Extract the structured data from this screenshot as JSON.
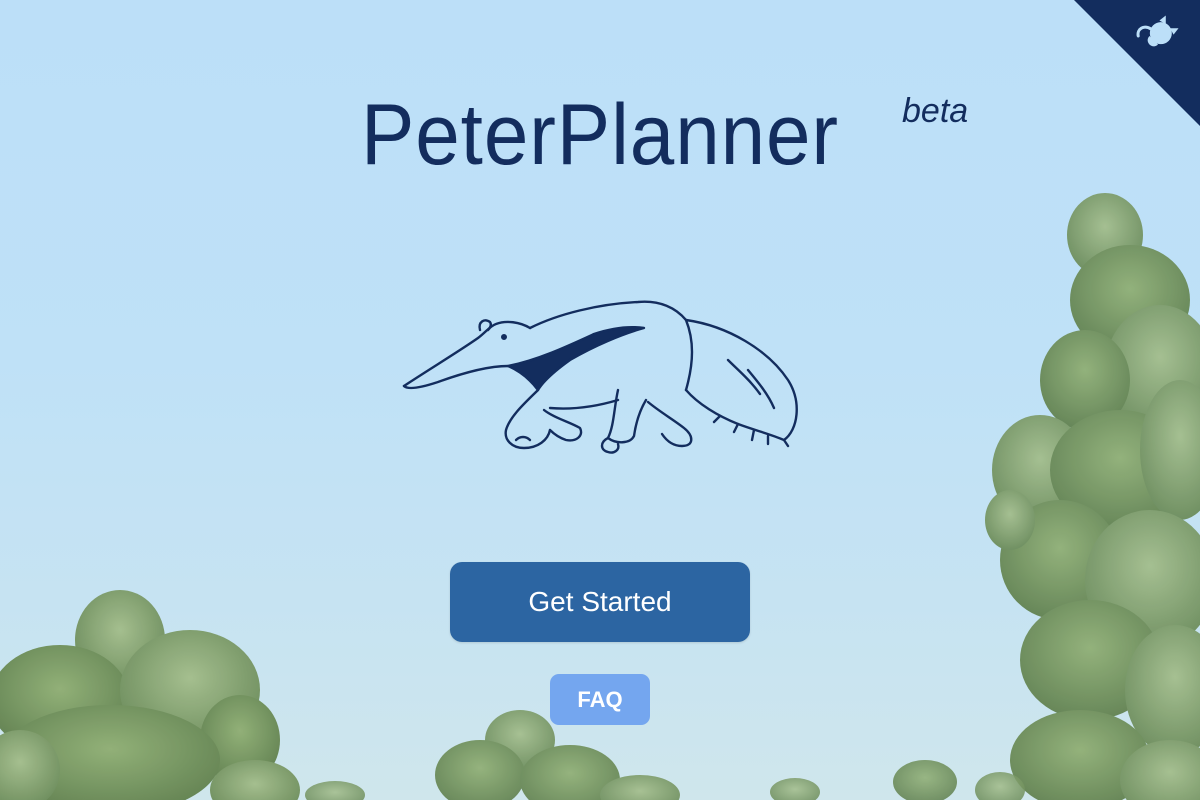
{
  "header": {
    "title": "PeterPlanner",
    "badge": "beta"
  },
  "mascot": {
    "icon": "anteater-icon"
  },
  "actions": {
    "get_started_label": "Get Started",
    "faq_label": "FAQ"
  },
  "corner_link": {
    "icon": "github-octocat-icon"
  },
  "colors": {
    "sky": "#bcdff8",
    "title": "#132d5e",
    "primary_button": "#2c65a2",
    "faq_button": "#74a6ef",
    "corner": "#132d5e",
    "foliage": "#6f8f58"
  }
}
